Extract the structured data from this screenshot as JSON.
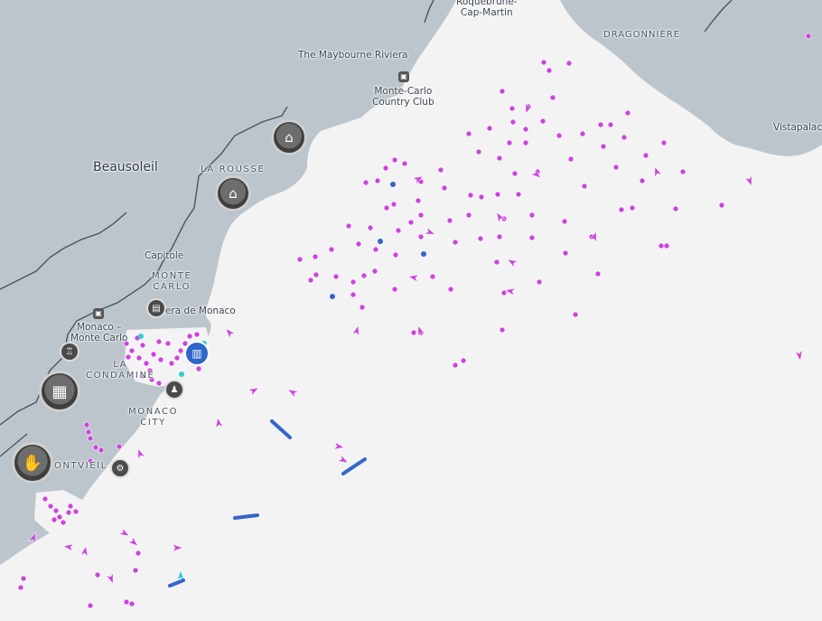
{
  "map": {
    "labels": {
      "roquebrune": "Roquebrune-\nCap-Martin",
      "dragonniere": "DRAGONNIÈRE",
      "maybourne": "The Maybourne Riviera",
      "country_club": "Monte-Carlo\nCountry Club",
      "vistapalace": "Vistapalac",
      "beausoleil": "Beausoleil",
      "la_rousse": "LA ROUSSE",
      "capitole": "Capitole",
      "monte_carlo": "MONTE\nCARLO",
      "riviera": "iera de Monaco",
      "monaco_station": "Monaco –\nMonte Carlo",
      "la_condamine": "LA\nCONDAMINE",
      "monaco_city": "MONACO\nCITY",
      "fontvieille": "ONTVIEIL"
    },
    "colors": {
      "land": "#bcc5cc",
      "sea": "#f3f3f4",
      "border": "#4a5560",
      "vessel_point": "#cc44dd",
      "vessel_blue": "#3366cc",
      "vessel_cyan": "#33cccc"
    },
    "icons": {
      "poi_dark": "poi-circle-icon",
      "train": "train-station-icon",
      "harbour": "harbour-icon"
    }
  }
}
